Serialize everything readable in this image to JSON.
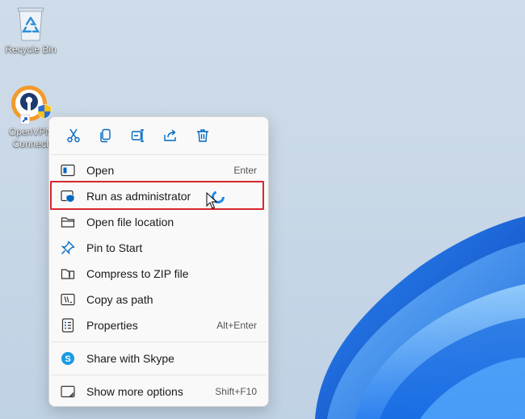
{
  "desktop": {
    "icons": [
      {
        "label": "Recycle Bin"
      },
      {
        "label": "OpenVPN Connect",
        "label_line1": "OpenVPN",
        "label_line2": "Connect"
      }
    ]
  },
  "context_menu": {
    "toolbar": [
      {
        "icon": "cut-icon"
      },
      {
        "icon": "copy-icon"
      },
      {
        "icon": "rename-icon"
      },
      {
        "icon": "share-icon"
      },
      {
        "icon": "delete-icon"
      }
    ],
    "items": [
      {
        "label": "Open",
        "shortcut": "Enter",
        "icon": "open-icon"
      },
      {
        "label": "Run as administrator",
        "shortcut": "",
        "icon": "shield-icon"
      },
      {
        "label": "Open file location",
        "shortcut": "",
        "icon": "folder-icon"
      },
      {
        "label": "Pin to Start",
        "shortcut": "",
        "icon": "pin-icon"
      },
      {
        "label": "Compress to ZIP file",
        "shortcut": "",
        "icon": "zip-icon"
      },
      {
        "label": "Copy as path",
        "shortcut": "",
        "icon": "copy-path-icon"
      },
      {
        "label": "Properties",
        "shortcut": "Alt+Enter",
        "icon": "properties-icon"
      },
      {
        "label": "Share with Skype",
        "shortcut": "",
        "icon": "skype-icon"
      },
      {
        "label": "Show more options",
        "shortcut": "Shift+F10",
        "icon": "more-options-icon"
      }
    ],
    "highlight_color": "#d7262f"
  },
  "colors": {
    "accent": "#0067c0",
    "wallpaper_blue": "#1a73e8"
  }
}
